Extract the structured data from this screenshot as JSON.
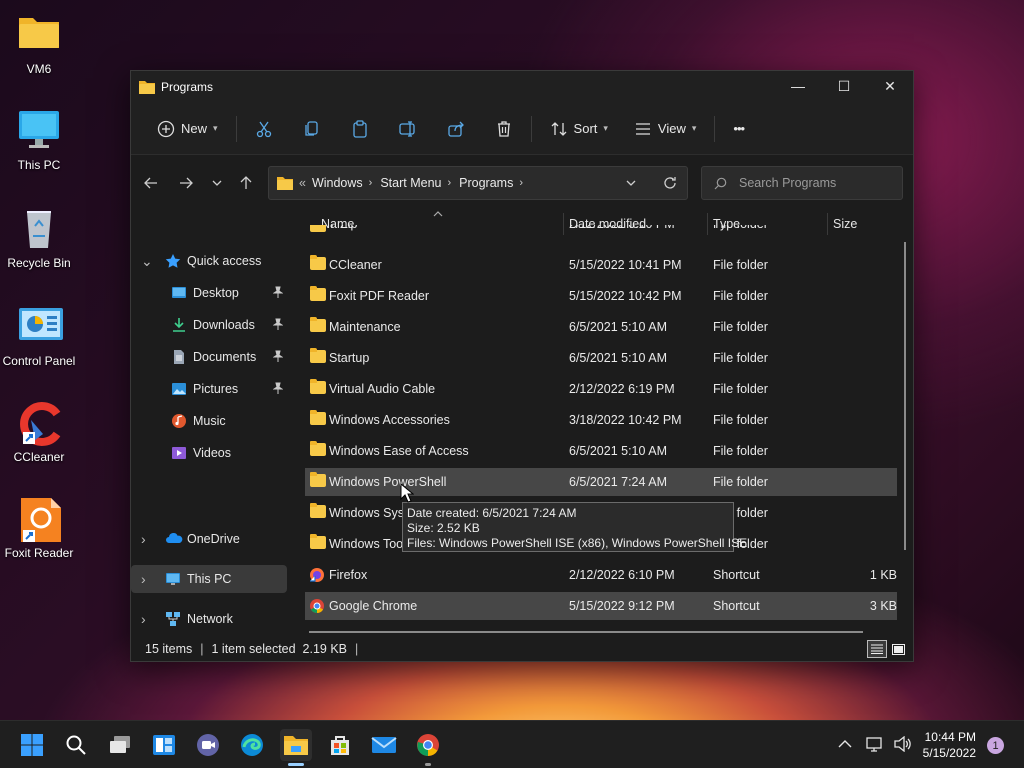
{
  "desktop": {
    "icons": [
      {
        "label": "VM6"
      },
      {
        "label": "This PC"
      },
      {
        "label": "Recycle Bin"
      },
      {
        "label": "Control Panel"
      },
      {
        "label": "CCleaner"
      },
      {
        "label": "Foxit Reader"
      }
    ]
  },
  "window": {
    "title": "Programs",
    "controls": {
      "minimize": "—",
      "maximize": "☐",
      "close": "✕"
    },
    "toolbar": {
      "new_label": "New",
      "sort_label": "Sort",
      "view_label": "View",
      "more_label": "•••"
    },
    "address": {
      "prefix": "«",
      "crumbs": [
        "Windows",
        "Start Menu",
        "Programs"
      ],
      "search_placeholder": "Search Programs"
    },
    "nav": {
      "quick_access": "Quick access",
      "items": [
        "Desktop",
        "Downloads",
        "Documents",
        "Pictures",
        "Music",
        "Videos"
      ],
      "onedrive": "OneDrive",
      "this_pc": "This PC",
      "network": "Network"
    },
    "columns": {
      "name": "Name",
      "date": "Date modified",
      "type": "Type",
      "size": "Size"
    },
    "files": [
      {
        "name": "7-Zip",
        "date": "2/12/2022 6:10 PM",
        "type": "File folder",
        "size": ""
      },
      {
        "name": "CCleaner",
        "date": "5/15/2022 10:41 PM",
        "type": "File folder",
        "size": ""
      },
      {
        "name": "Foxit PDF Reader",
        "date": "5/15/2022 10:42 PM",
        "type": "File folder",
        "size": ""
      },
      {
        "name": "Maintenance",
        "date": "6/5/2021 5:10 AM",
        "type": "File folder",
        "size": ""
      },
      {
        "name": "Startup",
        "date": "6/5/2021 5:10 AM",
        "type": "File folder",
        "size": ""
      },
      {
        "name": "Virtual Audio Cable",
        "date": "2/12/2022 6:19 PM",
        "type": "File folder",
        "size": ""
      },
      {
        "name": "Windows Accessories",
        "date": "3/18/2022 10:42 PM",
        "type": "File folder",
        "size": ""
      },
      {
        "name": "Windows Ease of Access",
        "date": "6/5/2021 5:10 AM",
        "type": "File folder",
        "size": ""
      },
      {
        "name": "Windows PowerShell",
        "date": "6/5/2021 7:24 AM",
        "type": "File folder",
        "size": ""
      },
      {
        "name": "Windows Syst",
        "date": "",
        "type": "File folder",
        "size": ""
      },
      {
        "name": "Windows Tool",
        "date": "",
        "type": "File folder",
        "size": ""
      },
      {
        "name": "Firefox",
        "date": "2/12/2022 6:10 PM",
        "type": "Shortcut",
        "size": "1 KB"
      },
      {
        "name": "Google Chrome",
        "date": "5/15/2022 9:12 PM",
        "type": "Shortcut",
        "size": "3 KB"
      }
    ],
    "tooltip": {
      "line1": "Date created: 6/5/2021 7:24 AM",
      "line2": "Size: 2.52 KB",
      "line3": "Files: Windows PowerShell ISE (x86), Windows PowerShell ISE"
    },
    "status": {
      "items": "15 items",
      "selected": "1 item selected  2.19 KB"
    }
  },
  "taskbar": {
    "time": "10:44 PM",
    "date": "5/15/2022",
    "notifications": "1"
  },
  "colors": {
    "accent": "#0078d4",
    "folder": "#f7c948",
    "selection": "#474747"
  }
}
